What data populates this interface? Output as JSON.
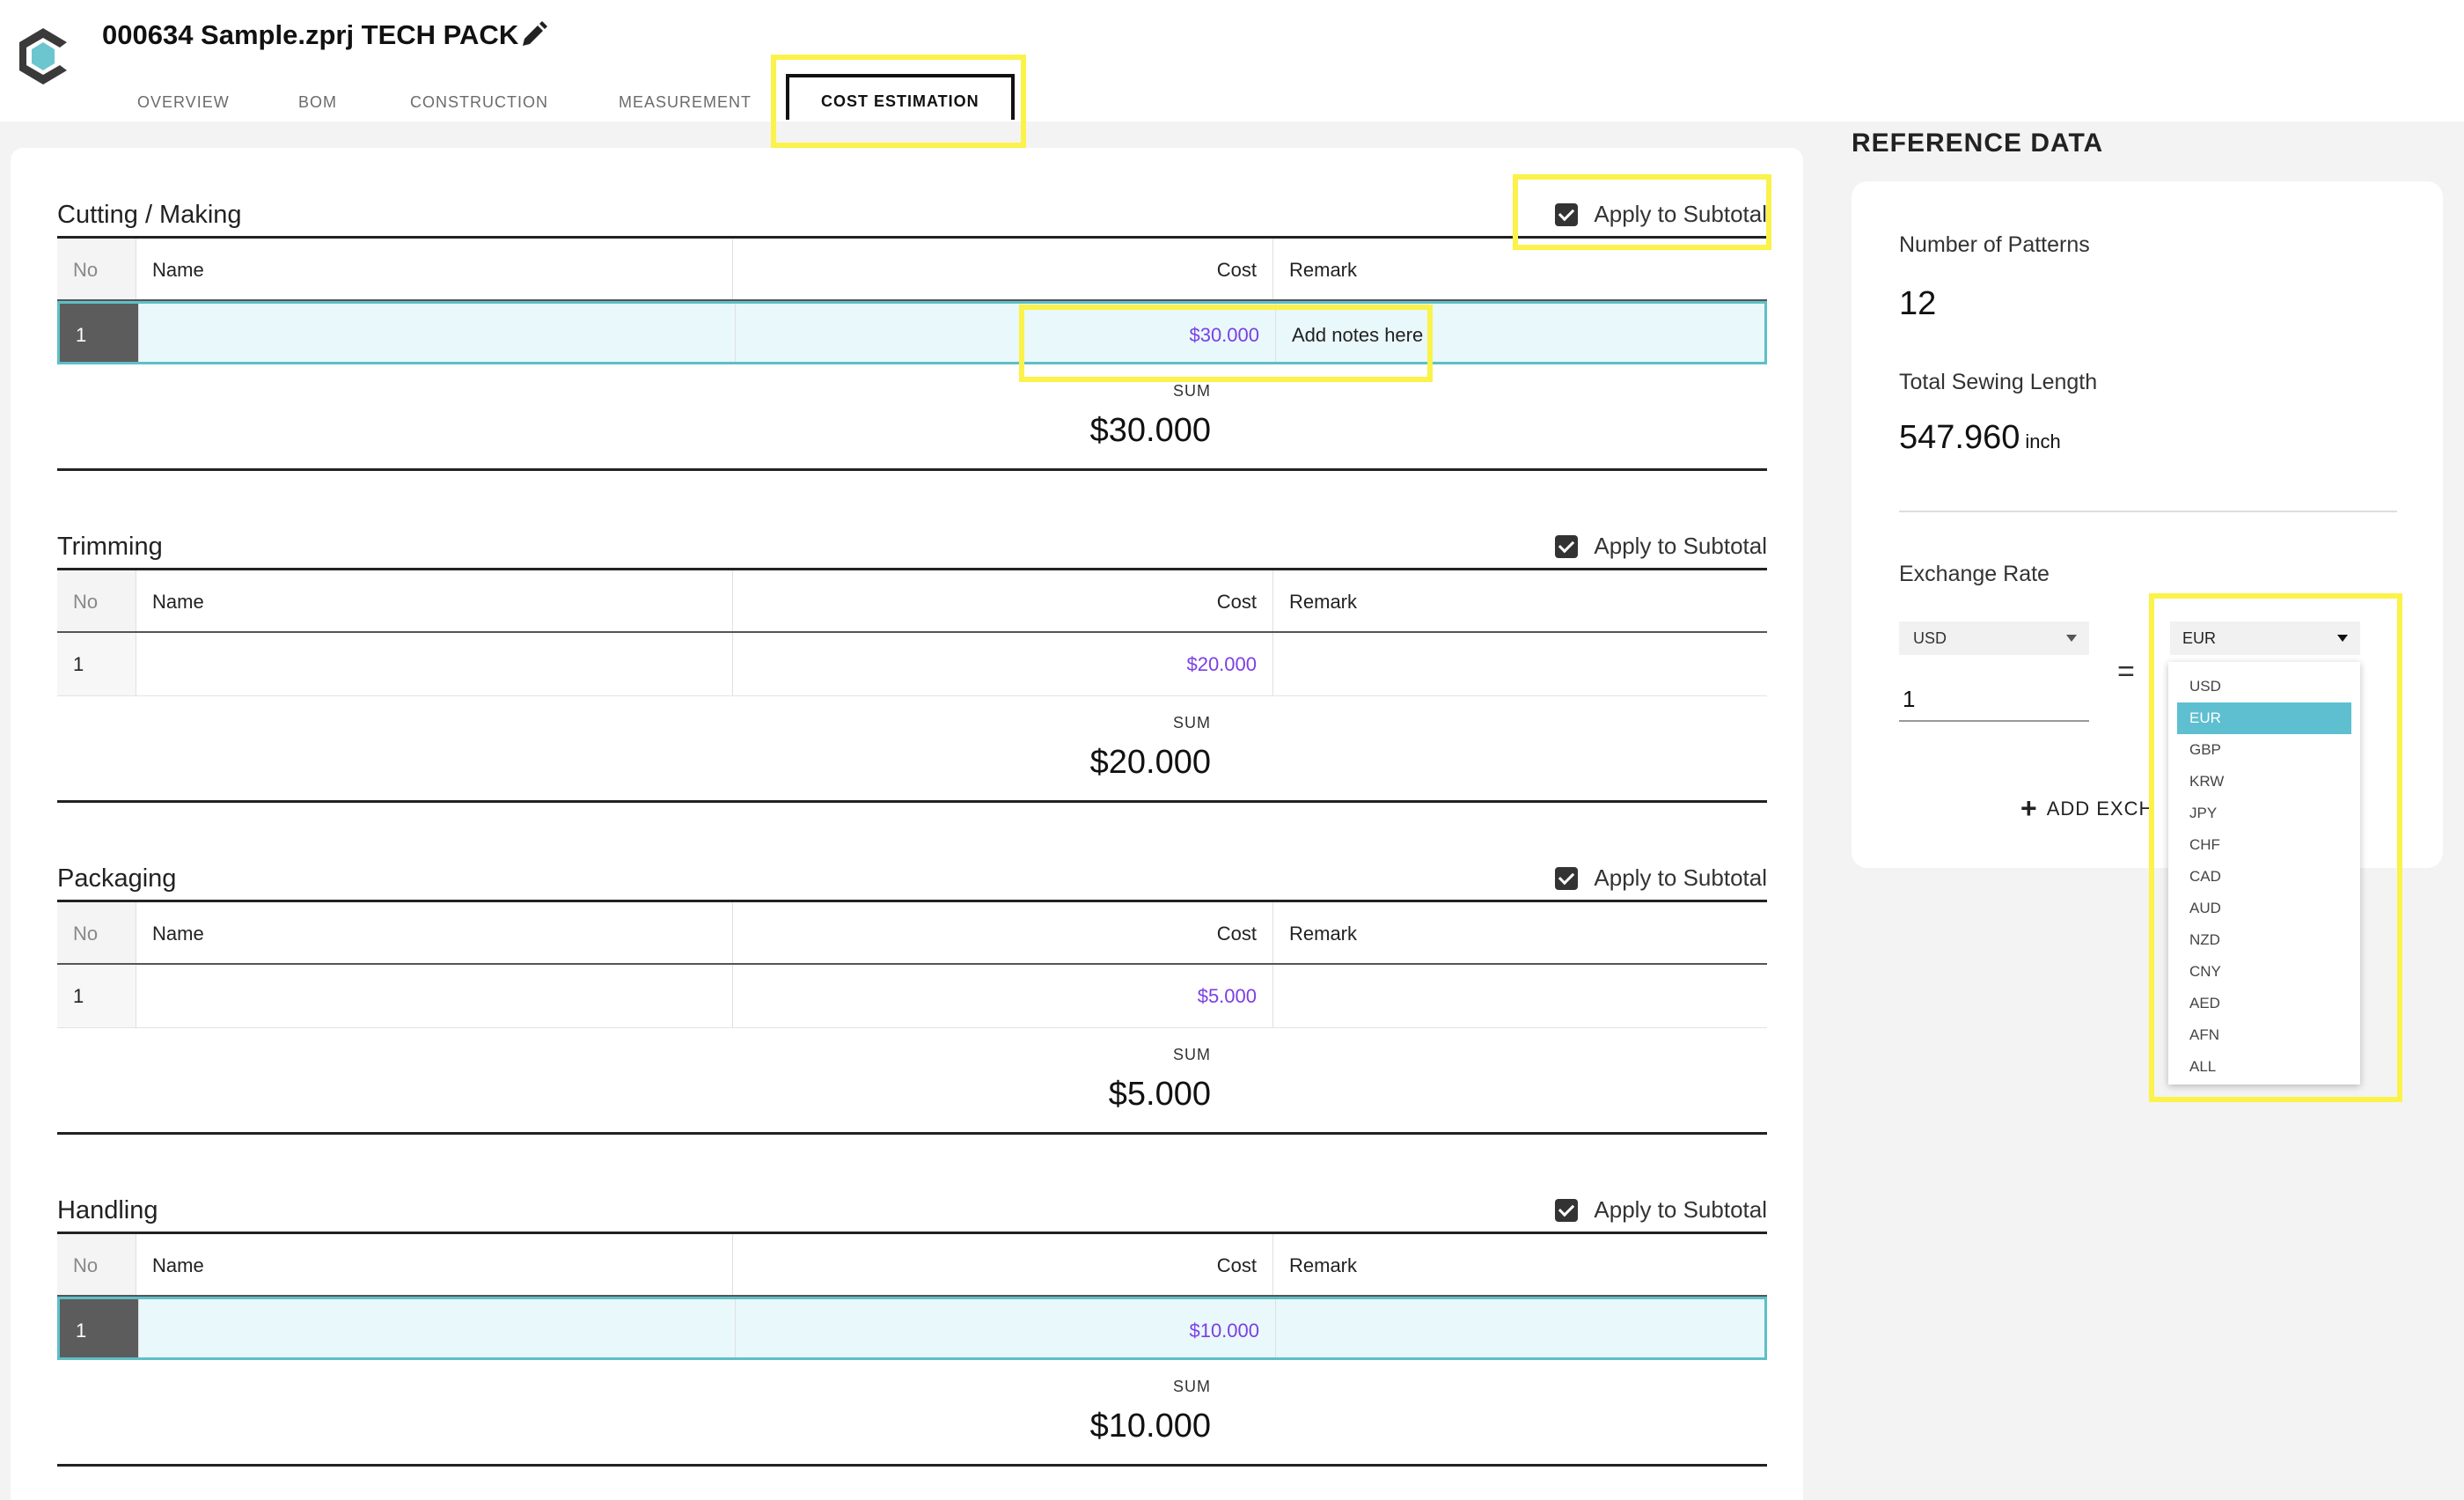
{
  "header": {
    "title": "000634 Sample.zprj TECH PACK",
    "tabs": [
      {
        "label": "OVERVIEW"
      },
      {
        "label": "BOM"
      },
      {
        "label": "CONSTRUCTION"
      },
      {
        "label": "MEASUREMENT"
      },
      {
        "label": "COST ESTIMATION",
        "active": true
      }
    ]
  },
  "table_headers": {
    "no": "No",
    "name": "Name",
    "cost": "Cost",
    "remark": "Remark"
  },
  "apply_label": "Apply to Subtotal",
  "sum_label": "SUM",
  "sections": [
    {
      "title": "Cutting / Making",
      "row": {
        "no": "1",
        "name": "",
        "cost": "$30.000",
        "remark": "Add notes here"
      },
      "sum": "$30.000"
    },
    {
      "title": "Trimming",
      "row": {
        "no": "1",
        "name": "",
        "cost": "$20.000",
        "remark": ""
      },
      "sum": "$20.000"
    },
    {
      "title": "Packaging",
      "row": {
        "no": "1",
        "name": "",
        "cost": "$5.000",
        "remark": ""
      },
      "sum": "$5.000"
    },
    {
      "title": "Handling",
      "row": {
        "no": "1",
        "name": "",
        "cost": "$10.000",
        "remark": ""
      },
      "sum": "$10.000"
    }
  ],
  "reference": {
    "heading": "REFERENCE DATA",
    "patterns_label": "Number of Patterns",
    "patterns_value": "12",
    "sewing_label": "Total Sewing Length",
    "sewing_value": "547.960",
    "sewing_unit": "inch",
    "exchange_label": "Exchange Rate",
    "from_currency": "USD",
    "rate_value": "1",
    "equals": "=",
    "to_currency": "EUR",
    "add_exchange_label": "ADD EXCH"
  },
  "currency_options": [
    "USD",
    "EUR",
    "GBP",
    "KRW",
    "JPY",
    "CHF",
    "CAD",
    "AUD",
    "NZD",
    "CNY",
    "AED",
    "AFN",
    "ALL"
  ],
  "selected_currency_index": 1,
  "colors": {
    "highlight": "#fbf24a",
    "accent": "#5ebfc7",
    "cost": "#7b3fe4"
  }
}
